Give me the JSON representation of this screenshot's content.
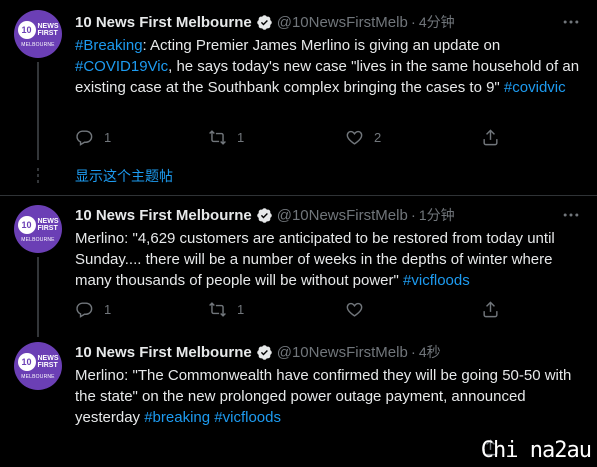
{
  "author": {
    "name": "10 News First Melbourne",
    "handle": "@10NewsFirstMelb",
    "avatar_number": "10",
    "avatar_line1": "NEWS",
    "avatar_line2": "FIRST",
    "avatar_city": "MELBOURNE"
  },
  "show_thread_label": "显示这个主题帖",
  "colors": {
    "link": "#1d9bf0",
    "muted": "#71767b",
    "background": "#000000",
    "avatar": "#6b3fb5"
  },
  "tweets": [
    {
      "time": "4分钟",
      "text_parts": [
        {
          "t": "#Breaking",
          "link": true
        },
        {
          "t": ": Acting Premier James Merlino is giving an update on ",
          "link": false
        },
        {
          "t": "#COVID19Vic",
          "link": true
        },
        {
          "t": ", he says today's new case \"lives in the same household of an existing case at the Southbank complex bringing the cases to 9\" ",
          "link": false
        },
        {
          "t": "#covidvic",
          "link": true
        }
      ],
      "replies": "1",
      "retweets": "1",
      "likes": "2"
    },
    {
      "time": "1分钟",
      "text_parts": [
        {
          "t": "Merlino: \"4,629 customers are anticipated to be restored from today until Sunday.... there will be a number of weeks in the depths of winter where many thousands of people will be without power\" ",
          "link": false
        },
        {
          "t": "#vicfloods",
          "link": true
        }
      ],
      "replies": "1",
      "retweets": "1",
      "likes": ""
    },
    {
      "time": "4秒",
      "text_parts": [
        {
          "t": "Merlino: \"The Commonwealth have confirmed they will be going 50-50 with the state\" on the new prolonged power outage payment, announced yesterday ",
          "link": false
        },
        {
          "t": "#breaking",
          "link": true
        },
        {
          "t": " ",
          "link": false
        },
        {
          "t": "#vicfloods",
          "link": true
        }
      ],
      "replies": "",
      "retweets": "",
      "likes": ""
    }
  ],
  "icons": [
    "verified-badge-icon",
    "more-icon",
    "reply-icon",
    "retweet-icon",
    "like-icon",
    "share-icon"
  ],
  "watermark": "Chi na2au"
}
